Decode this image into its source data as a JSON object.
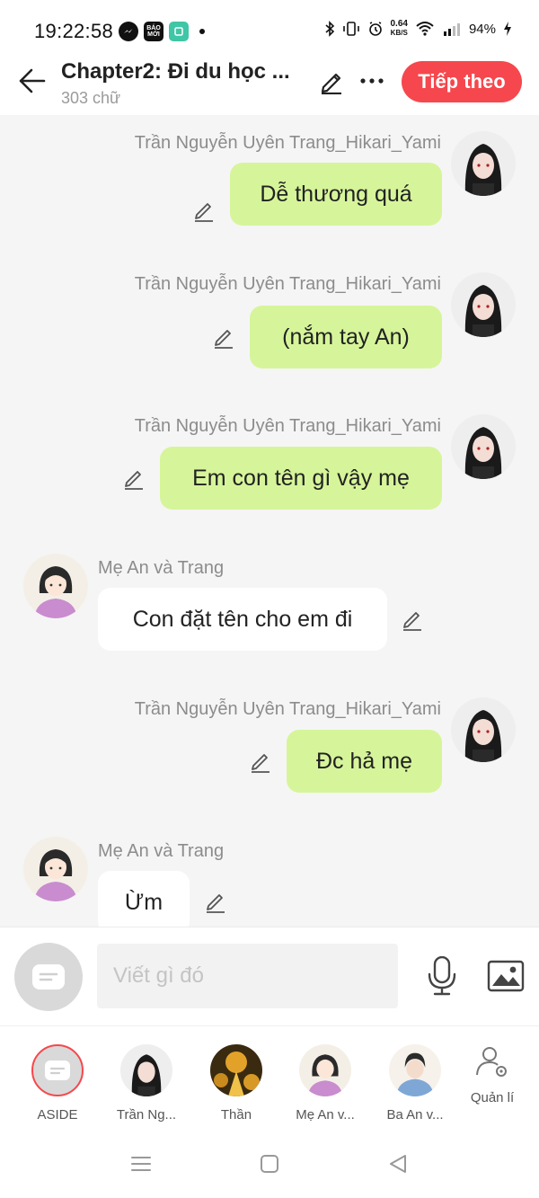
{
  "status_bar": {
    "time": "19:22:58",
    "baomoi_label": "BÁO MỚI",
    "net_speed_value": "0.64",
    "net_speed_unit": "KB/S",
    "battery": "94%"
  },
  "header": {
    "title": "Chapter2: Đi du học ...",
    "word_count": "303 chữ",
    "next_label": "Tiếp theo"
  },
  "messages": [
    {
      "side": "right",
      "sender": "Trần Nguyễn Uyên Trang_Hikari_Yami",
      "text": "Dễ thương quá"
    },
    {
      "side": "right",
      "sender": "Trần Nguyễn Uyên Trang_Hikari_Yami",
      "text": "(nắm tay An)"
    },
    {
      "side": "right",
      "sender": "Trần Nguyễn Uyên Trang_Hikari_Yami",
      "text": "Em con tên gì vậy mẹ"
    },
    {
      "side": "left",
      "sender": "Mẹ An và Trang",
      "text": "Con đặt tên cho em đi"
    },
    {
      "side": "right",
      "sender": "Trần Nguyễn Uyên Trang_Hikari_Yami",
      "text": "Đc hả mẹ"
    },
    {
      "side": "left",
      "sender": "Mẹ An và Trang",
      "text": "Ừm"
    }
  ],
  "input": {
    "placeholder": "Viết gì đó"
  },
  "characters": [
    {
      "name": "ASIDE"
    },
    {
      "name": "Trần Ng..."
    },
    {
      "name": "Thần"
    },
    {
      "name": "Mẹ An v..."
    },
    {
      "name": "Ba An v..."
    }
  ],
  "manage_label": "Quản lí",
  "colors": {
    "accent": "#f5474d",
    "bubble_self": "#d6f59a",
    "bubble_other": "#ffffff",
    "chat_bg": "#f5f5f5"
  }
}
